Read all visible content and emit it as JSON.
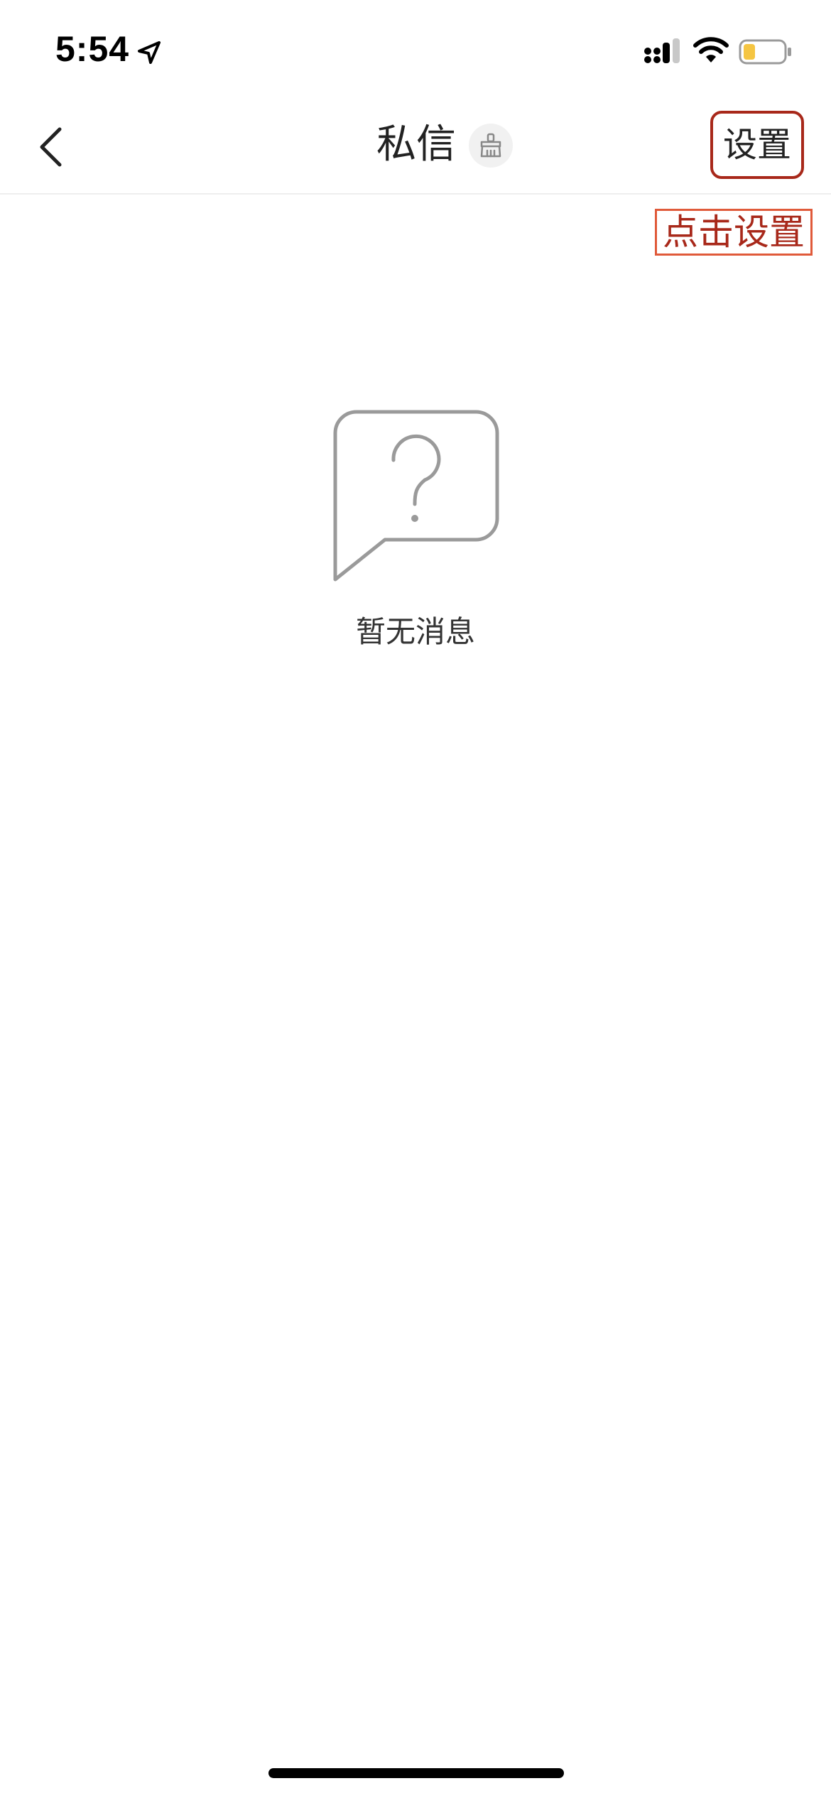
{
  "status_bar": {
    "time": "5:54"
  },
  "nav": {
    "title": "私信",
    "settings_label": "设置"
  },
  "annotation": {
    "label": "点击设置"
  },
  "empty_state": {
    "message": "暂无消息"
  },
  "colors": {
    "annotation_border": "#e05a3a",
    "annotation_text": "#a8281a",
    "battery_fill": "#f5c542"
  },
  "icons": {
    "back": "back-chevron-icon",
    "broom": "broom-clean-icon",
    "empty": "question-chat-bubble-icon"
  }
}
